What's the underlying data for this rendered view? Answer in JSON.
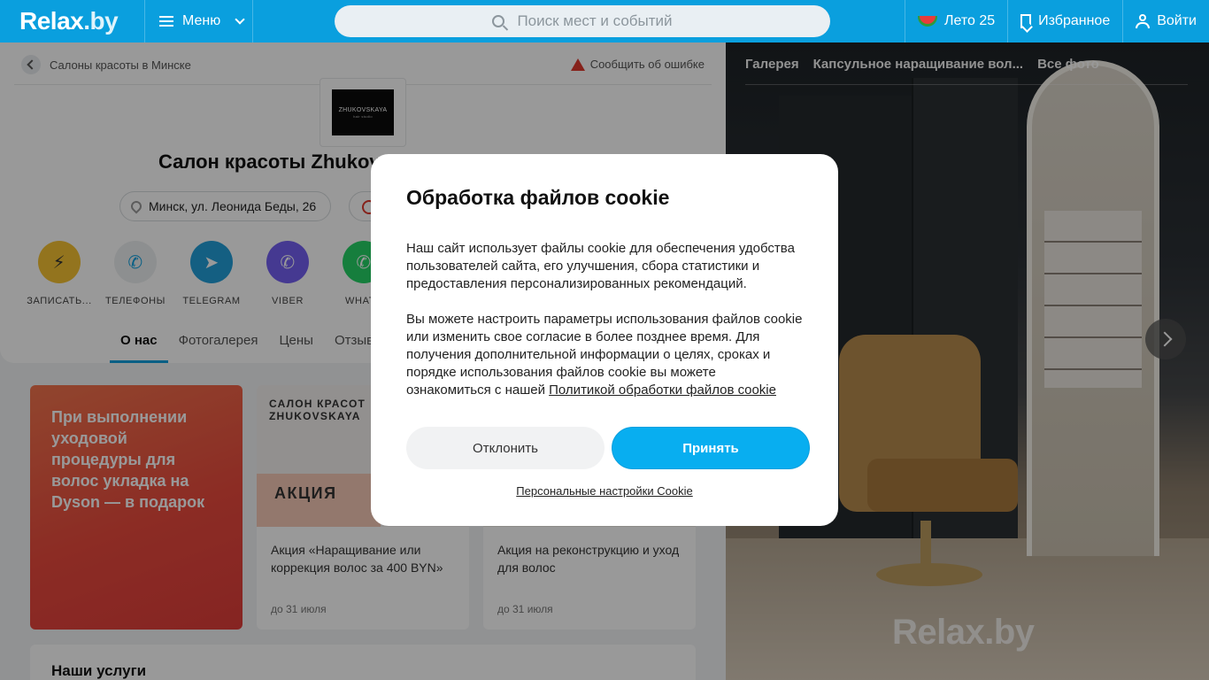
{
  "header": {
    "logo": "Relax",
    "logo_suffix": ".by",
    "menu_label": "Меню",
    "search_placeholder": "Поиск мест и событий",
    "summer_label": "Лето 25",
    "favorites_label": "Избранное",
    "login_label": "Войти"
  },
  "breadcrumb": {
    "label": "Салоны красоты в Минске"
  },
  "report": {
    "label": "Сообщить об ошибке"
  },
  "salon": {
    "logo_text": "ZHUKOVSKAYA",
    "logo_sub": "hair studio",
    "title": "Салон красоты Zhukovskaya Hair Studio",
    "address": "Минск, ул. Леонида Беды, 26"
  },
  "actions": [
    {
      "label": "ЗАПИСАТЬ...",
      "icon": "booking-icon"
    },
    {
      "label": "ТЕЛЕФОНЫ",
      "icon": "phone-icon"
    },
    {
      "label": "TELEGRAM",
      "icon": "telegram-icon"
    },
    {
      "label": "VIBER",
      "icon": "viber-icon"
    },
    {
      "label": "WHATS",
      "icon": "whatsapp-icon"
    }
  ],
  "tabs": [
    "О нас",
    "Фотогалерея",
    "Цены",
    "Отзывы"
  ],
  "promos": {
    "big_text": "При выполнении уходовой процедуры для волос укладка на Dyson — в подарок",
    "card1": {
      "brand": "САЛОН КРАСОТ",
      "brand2": "ZHUKOVSKAYA",
      "badge": "АКЦИЯ",
      "text": "Акция «Наращивание или коррекция волос за 400 BYN»",
      "date": "до 31 июля"
    },
    "card2": {
      "text": "Акция на реконструкцию и уход для волос",
      "date": "до 31 июля"
    }
  },
  "services": {
    "title": "Наши услуги"
  },
  "gallery": {
    "tabs": [
      "Галерея",
      "Капсульное наращивание вол...",
      "Все фото"
    ],
    "watermark": "Relax.by"
  },
  "cookie_modal": {
    "title": "Обработка файлов cookie",
    "para1": "Наш сайт использует файлы cookie для обеспечения удобства пользователей сайта, его улучшения, сбора статистики и предоставления персонализированных рекомендаций.",
    "para2": "Вы можете настроить параметры использования файлов cookie или изменить свое согласие в более позднее время. Для получения дополнительной информации о целях, сроках и порядке использования файлов cookie вы можете ознакомиться с нашей",
    "policy_link": "Политикой обработки файлов cookie",
    "decline_label": "Отклонить",
    "accept_label": "Принять",
    "personal_label": "Персональные настройки Cookie"
  }
}
